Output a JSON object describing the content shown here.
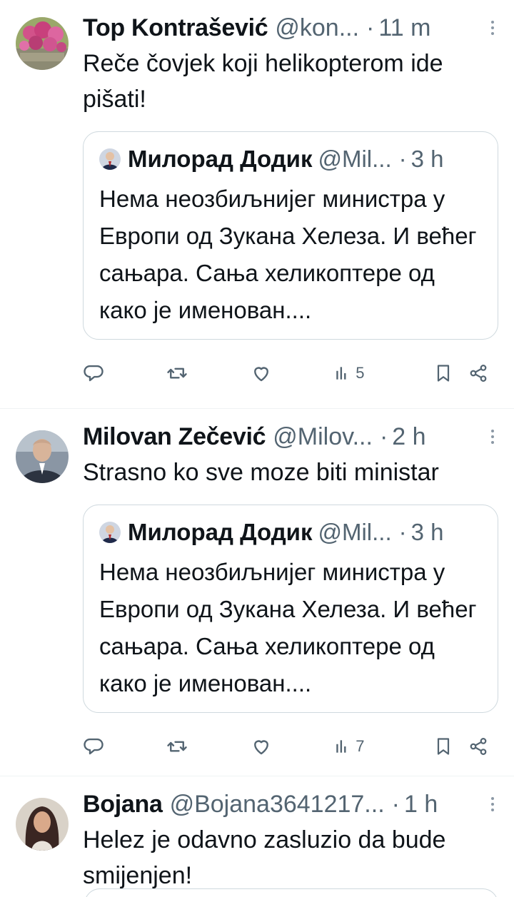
{
  "tweets": [
    {
      "name": "Top Kontrašević",
      "handle": "@kon...",
      "time": "11 m",
      "text": "Reče čovjek koji helikopterom ide pišati!",
      "views": "",
      "avatar_color": "#c0486e",
      "quote": {
        "name": "Милорад Додик",
        "handle": "@Mil...",
        "time": "3 h",
        "text": "Нема неозбиљнијег министра у Европи од Зукана Хелеза. И већег сањара. Сања хеликоптере од како је именован...."
      },
      "stats": {
        "views": "5"
      }
    },
    {
      "name": "Milovan Zečević",
      "handle": "@Milov...",
      "time": "2 h",
      "text": "Strasno ko sve moze biti ministar",
      "avatar_color": "#3b4350",
      "quote": {
        "name": "Милорад Додик",
        "handle": "@Mil...",
        "time": "3 h",
        "text": "Нема неозбиљнијег министра у Европи од Зукана Хелеза. И већег сањара. Сања хеликоптере од како је именован...."
      },
      "stats": {
        "views": "7"
      }
    },
    {
      "name": "Bojana",
      "handle": "@Bojana3641217...",
      "time": "1 h",
      "text": "Helez je odavno zasluzio da bude smijenjen!",
      "avatar_color": "#5a3a2e"
    }
  ],
  "separator": "·",
  "colors": {
    "text": "#0f1419",
    "muted": "#536471",
    "border": "#cfd9de"
  },
  "icons": [
    "reply-icon",
    "retweet-icon",
    "like-icon",
    "views-icon",
    "bookmark-icon",
    "share-icon",
    "more-icon"
  ]
}
